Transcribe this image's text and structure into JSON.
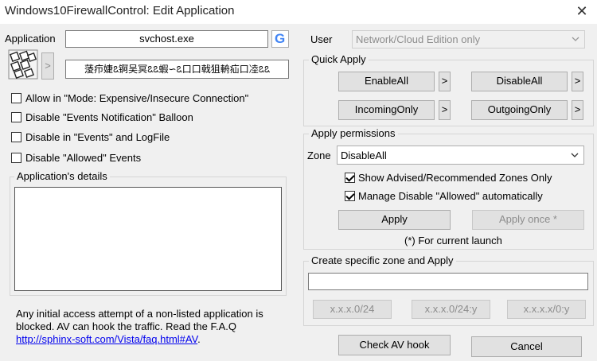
{
  "window": {
    "title": "Windows10FirewallControl: Edit Application",
    "close_glyph": "✕"
  },
  "left": {
    "application_label": "Application",
    "application_value": "svchost.exe",
    "google_glyph": "G",
    "arrow_glyph": ">",
    "garbled_text": "蔆疖婕ꢣ锕吴冥ꢣꢣ蝦∽ꢣ口口戟狙輈疝口㓐ꢣꢣ",
    "checkboxes": [
      {
        "label": "Allow in \"Mode: Expensive/Insecure Connection\"",
        "checked": false
      },
      {
        "label": "Disable \"Events Notification\" Balloon",
        "checked": false
      },
      {
        "label": "Disable in \"Events\" and LogFile",
        "checked": false
      },
      {
        "label": "Disable \"Allowed\" Events",
        "checked": false
      }
    ],
    "details_title": "Application's details",
    "info_text_1": "Any initial access attempt of a non-listed application is",
    "info_text_2": "blocked. AV can hook the traffic. Read the F.A.Q",
    "info_link": "http://sphinx-soft.com/Vista/faq.html#AV",
    "info_link_suffix": "."
  },
  "right": {
    "user_label": "User",
    "user_value": "Network/Cloud Edition only",
    "quick_apply_title": "Quick Apply",
    "quick_buttons": {
      "enable_all": "EnableAll",
      "disable_all": "DisableAll",
      "incoming_only": "IncomingOnly",
      "outgoing_only": "OutgoingOnly",
      "arrow": ">"
    },
    "permissions_title": "Apply permissions",
    "zone_label": "Zone",
    "zone_value": "DisableAll",
    "option_show_advised": {
      "label": "Show Advised/Recommended Zones Only",
      "checked": true
    },
    "option_manage_disable": {
      "label": "Manage Disable \"Allowed\" automatically",
      "checked": true
    },
    "apply_label": "Apply",
    "apply_once_label": "Apply once *",
    "current_launch_note": "(*) For current launch",
    "create_zone_title": "Create specific zone and Apply",
    "zone_input_value": "",
    "ip_buttons": [
      "x.x.x.0/24",
      "x.x.x.0/24:y",
      "x.x.x.x/0:y"
    ],
    "check_av_hook": "Check AV hook",
    "cancel": "Cancel"
  }
}
